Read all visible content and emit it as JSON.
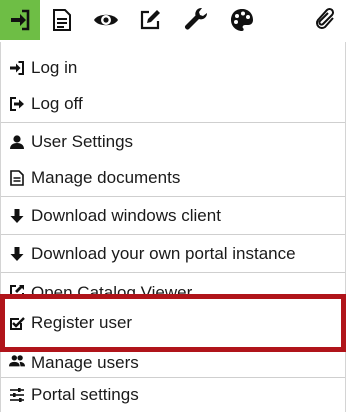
{
  "toolbar": {
    "icons": [
      "login-icon",
      "document-icon",
      "eye-icon",
      "edit-icon",
      "wrench-icon",
      "palette-icon",
      "paperclip-icon"
    ],
    "active_color": "#6ebe45"
  },
  "menu": {
    "items": [
      {
        "label": "Log in",
        "icon": "login-icon"
      },
      {
        "label": "Log off",
        "icon": "logoff-icon"
      },
      {
        "label": "User Settings",
        "icon": "user-icon"
      },
      {
        "label": "Manage documents",
        "icon": "document-icon"
      },
      {
        "label": "Download windows client",
        "icon": "download-arrow-icon"
      },
      {
        "label": "Download your own portal instance",
        "icon": "download-arrow-icon"
      },
      {
        "label": "Open Catalog Viewer",
        "icon": "external-link-icon"
      },
      {
        "label": "Register user",
        "icon": "checkbox-icon"
      },
      {
        "label": "Manage users",
        "icon": "users-icon"
      },
      {
        "label": "Portal settings",
        "icon": "sliders-icon"
      }
    ]
  },
  "highlight_color": "#b0141a"
}
